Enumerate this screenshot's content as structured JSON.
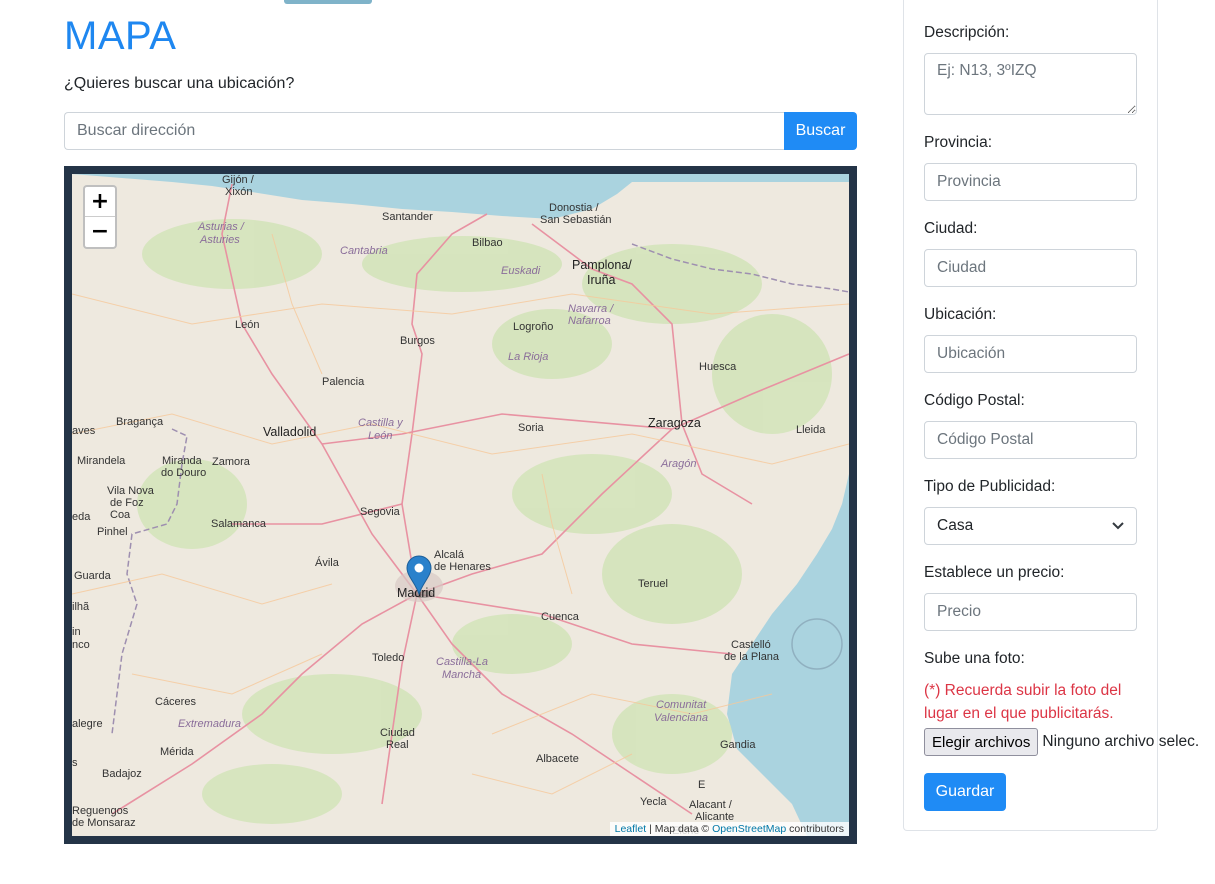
{
  "page": {
    "title": "MAPA",
    "subtitle": "¿Quieres buscar una ubicación?"
  },
  "search": {
    "placeholder": "Buscar dirección",
    "button_label": "Buscar"
  },
  "map": {
    "zoom_in_label": "+",
    "zoom_out_label": "−",
    "attribution": {
      "leaflet": "Leaflet",
      "separator": " | Map data © ",
      "osm": "OpenStreetMap",
      "suffix": " contributors"
    },
    "marker_label": "Madrid",
    "cities": [
      "Gijón / Xixón",
      "Santander",
      "Donostia / San Sebastián",
      "Bilbao",
      "Pamplona/ Iruña",
      "León",
      "Burgos",
      "Logroño",
      "Huesca",
      "Palencia",
      "Valladolid",
      "Soria",
      "Zaragoza",
      "Lleida",
      "Bragança",
      "Mirandela",
      "Miranda do Douro",
      "Zamora",
      "Vila Nova de Foz Coa",
      "Pinhel",
      "Salamanca",
      "Segovia",
      "Ávila",
      "Alcalá de Henares",
      "Guarda",
      "Teruel",
      "Cuenca",
      "Toledo",
      "Castelló de la Plana",
      "Cáceres",
      "Ciudad Real",
      "Mérida",
      "Albacete",
      "Gandia",
      "Badajoz",
      "Reguengos de Monsaraz",
      "Yecla",
      "Alcant / Alicante",
      "Elche"
    ],
    "regions": [
      "Asturias / Asturies",
      "Cantabria",
      "Euskadi",
      "Navarra / Nafarroa",
      "La Rioja",
      "Castilla y León",
      "Aragón",
      "Castilla-La Mancha",
      "Extremadura",
      "Comunitat Valenciana"
    ]
  },
  "form": {
    "descripcion": {
      "label": "Descripción:",
      "placeholder": "Ej: N13, 3ºIZQ"
    },
    "provincia": {
      "label": "Provincia:",
      "placeholder": "Provincia"
    },
    "ciudad": {
      "label": "Ciudad:",
      "placeholder": "Ciudad"
    },
    "ubicacion": {
      "label": "Ubicación:",
      "placeholder": "Ubicación"
    },
    "codigo_postal": {
      "label": "Código Postal:",
      "placeholder": "Código Postal"
    },
    "tipo_publicidad": {
      "label": "Tipo de Publicidad:",
      "selected": "Casa"
    },
    "precio": {
      "label": "Establece un precio:",
      "placeholder": "Precio"
    },
    "foto": {
      "label": "Sube una foto:",
      "warning": "(*) Recuerda subir la foto del lugar en el que publicitarás.",
      "file_button": "Elegir archivos",
      "file_status": "Ninguno archivo selec."
    },
    "save_label": "Guardar"
  },
  "colors": {
    "primary": "#1f8bf5",
    "title": "#1e87f0",
    "warning": "#dc3545",
    "map_frame": "#243447",
    "sea": "#aad3df",
    "land": "#eee9df"
  }
}
